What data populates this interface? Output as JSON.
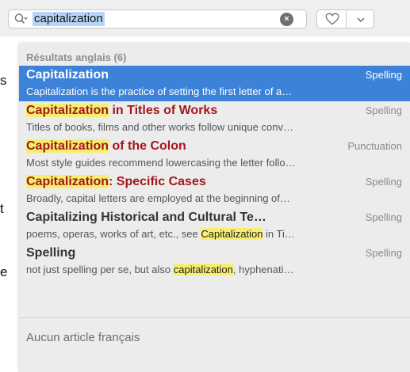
{
  "background": {
    "chars": [
      "s",
      "t",
      "e"
    ]
  },
  "toolbar": {
    "search_value": "capitalization",
    "clear_label": "×"
  },
  "dropdown": {
    "section_header": "Résultats anglais (6)",
    "results": [
      {
        "title_parts": [
          {
            "text": "Capitalization",
            "style": "plain"
          }
        ],
        "category": "Spelling",
        "snippet_parts": [
          {
            "text": "Capitalization is the practice of setting the first letter of a…",
            "style": "plain"
          }
        ],
        "selected": true
      },
      {
        "title_parts": [
          {
            "text": "Capitalization",
            "style": "hl"
          },
          {
            "text": " in Titles of Works",
            "style": "red"
          }
        ],
        "category": "Spelling",
        "snippet_parts": [
          {
            "text": "Titles of books, films and other works follow unique conv…",
            "style": "plain"
          }
        ],
        "selected": false
      },
      {
        "title_parts": [
          {
            "text": "Capitalization",
            "style": "hl"
          },
          {
            "text": " of the Colon",
            "style": "red"
          }
        ],
        "category": "Punctuation",
        "snippet_parts": [
          {
            "text": "Most style guides recommend lowercasing the letter follo…",
            "style": "plain"
          }
        ],
        "selected": false
      },
      {
        "title_parts": [
          {
            "text": "Capitalization",
            "style": "hl"
          },
          {
            "text": ": Specific Cases",
            "style": "red"
          }
        ],
        "category": "Spelling",
        "snippet_parts": [
          {
            "text": "Broadly, capital letters are employed at the beginning of…",
            "style": "plain"
          }
        ],
        "selected": false
      },
      {
        "title_parts": [
          {
            "text": "Capitalizing Historical and Cultural Te…",
            "style": "plain"
          }
        ],
        "category": "Spelling",
        "snippet_parts": [
          {
            "text": "poems, operas, works of art, etc., see ",
            "style": "plain"
          },
          {
            "text": "Capitalization",
            "style": "hl"
          },
          {
            "text": " in Ti…",
            "style": "plain"
          }
        ],
        "selected": false
      },
      {
        "title_parts": [
          {
            "text": "Spelling",
            "style": "plain"
          }
        ],
        "category": "Spelling",
        "snippet_parts": [
          {
            "text": "not just spelling per se, but also ",
            "style": "plain"
          },
          {
            "text": "capitalization",
            "style": "hl"
          },
          {
            "text": ", hyphenati…",
            "style": "plain"
          }
        ],
        "selected": false
      }
    ],
    "no_results_text": "Aucun article français"
  },
  "colors": {
    "selection": "#3c82d8",
    "highlight": "#f6ee6e",
    "match_red": "#a3171c",
    "search_selection": "#b7d4f7"
  },
  "icons": {
    "search": "magnifier-with-dropdown-icon",
    "clear": "clear-x-circle-icon",
    "favorite": "heart-outline-icon",
    "menu": "chevron-down-icon"
  }
}
